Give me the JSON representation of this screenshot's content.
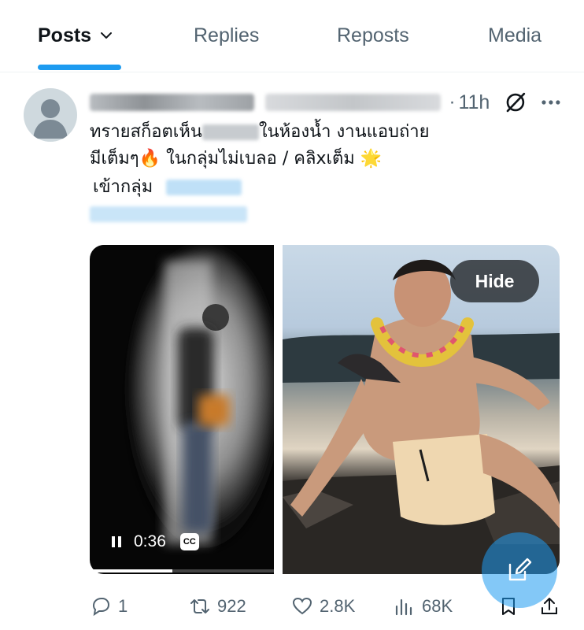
{
  "tabs": [
    {
      "label": "Posts",
      "active": true
    },
    {
      "label": "Replies"
    },
    {
      "label": "Reposts"
    },
    {
      "label": "Media"
    }
  ],
  "post": {
    "time": "11h",
    "separator": "·",
    "text_line1_a": "ทรายสก็อตเห็น",
    "text_line1_b": "ในห้องน้ำ งานแอบถ่าย",
    "text_line2": "มีเต็มๆ🔥 ในกลุ่มไม่เบลอ / คลิxเต็ม 🌟",
    "text_line3": "เข้ากลุ่ม",
    "video": {
      "time": "0:36",
      "cc_label": "CC",
      "progress": 0.45
    },
    "hide_label": "Hide",
    "stats": {
      "replies": "1",
      "reposts": "922",
      "likes": "2.8K",
      "views": "68K"
    }
  },
  "colors": {
    "accent": "#1d9bf0",
    "muted": "#536471",
    "text": "#0f1419"
  },
  "icons": [
    "chevron-down-icon",
    "grok-icon",
    "more-icon",
    "pause-icon",
    "cc-icon",
    "reply-icon",
    "repost-icon",
    "like-icon",
    "views-icon",
    "bookmark-icon",
    "share-icon",
    "compose-icon"
  ]
}
